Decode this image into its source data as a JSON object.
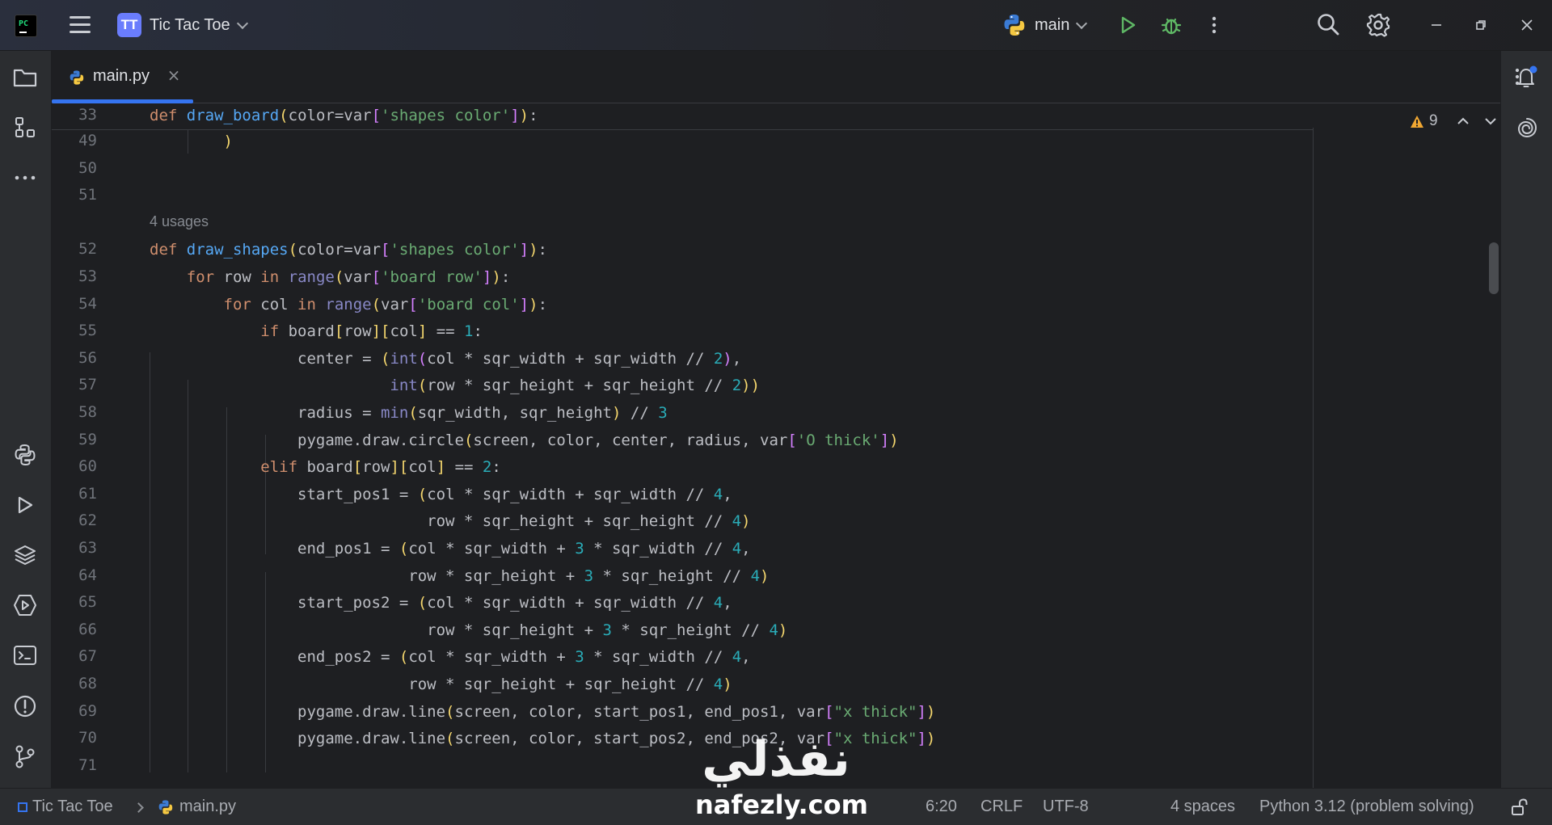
{
  "titlebar": {
    "logo_text": "PC",
    "project_badge": "TT",
    "project_name": "Tic Tac Toe",
    "run_config": "main"
  },
  "tabs": [
    {
      "label": "main.py",
      "active": true
    }
  ],
  "editor": {
    "sticky": {
      "number": "33",
      "code": "def draw_board(color=var['shapes color']):"
    },
    "usage_hint": "4 usages",
    "lines": [
      {
        "number": "49",
        "code": "        )"
      },
      {
        "number": "50",
        "code": ""
      },
      {
        "number": "51",
        "code": ""
      },
      {
        "number": "52",
        "code": "def draw_shapes(color=var['shapes color']):"
      },
      {
        "number": "53",
        "code": "    for row in range(var['board row']):"
      },
      {
        "number": "54",
        "code": "        for col in range(var['board col']):"
      },
      {
        "number": "55",
        "code": "            if board[row][col] == 1:"
      },
      {
        "number": "56",
        "code": "                center = (int(col * sqr_width + sqr_width // 2),"
      },
      {
        "number": "57",
        "code": "                          int(row * sqr_height + sqr_height // 2))"
      },
      {
        "number": "58",
        "code": "                radius = min(sqr_width, sqr_height) // 3"
      },
      {
        "number": "59",
        "code": "                pygame.draw.circle(screen, color, center, radius, var['O thick'])"
      },
      {
        "number": "60",
        "code": "            elif board[row][col] == 2:"
      },
      {
        "number": "61",
        "code": "                start_pos1 = (col * sqr_width + sqr_width // 4,"
      },
      {
        "number": "62",
        "code": "                              row * sqr_height + sqr_height // 4)"
      },
      {
        "number": "63",
        "code": "                end_pos1 = (col * sqr_width + 3 * sqr_width // 4,"
      },
      {
        "number": "64",
        "code": "                            row * sqr_height + 3 * sqr_height // 4)"
      },
      {
        "number": "65",
        "code": "                start_pos2 = (col * sqr_width + sqr_width // 4,"
      },
      {
        "number": "66",
        "code": "                              row * sqr_height + 3 * sqr_height // 4)"
      },
      {
        "number": "67",
        "code": "                end_pos2 = (col * sqr_width + 3 * sqr_width // 4,"
      },
      {
        "number": "68",
        "code": "                            row * sqr_height + sqr_height // 4)"
      },
      {
        "number": "69",
        "code": "                pygame.draw.line(screen, color, start_pos1, end_pos1, var[\"x thick\"])"
      },
      {
        "number": "70",
        "code": "                pygame.draw.line(screen, color, start_pos2, end_pos2, var[\"x thick\"])"
      },
      {
        "number": "71",
        "code": ""
      }
    ],
    "warning_count": "9"
  },
  "statusbar": {
    "project": "Tic Tac Toe",
    "file": "main.py",
    "position": "6:20",
    "line_separator": "CRLF",
    "encoding": "UTF-8",
    "indent": "4 spaces",
    "interpreter": "Python 3.12 (problem solving)"
  },
  "watermark": {
    "arabic": "نفذلي",
    "latin": "nafezly.com"
  },
  "colors": {
    "keyword": "#cf8e6d",
    "function": "#56a8f5",
    "builtin": "#8888c6",
    "string": "#6aab73",
    "number": "#2aacb8",
    "accent": "#3574f0",
    "run": "#5fb865",
    "warning": "#f0a732"
  }
}
